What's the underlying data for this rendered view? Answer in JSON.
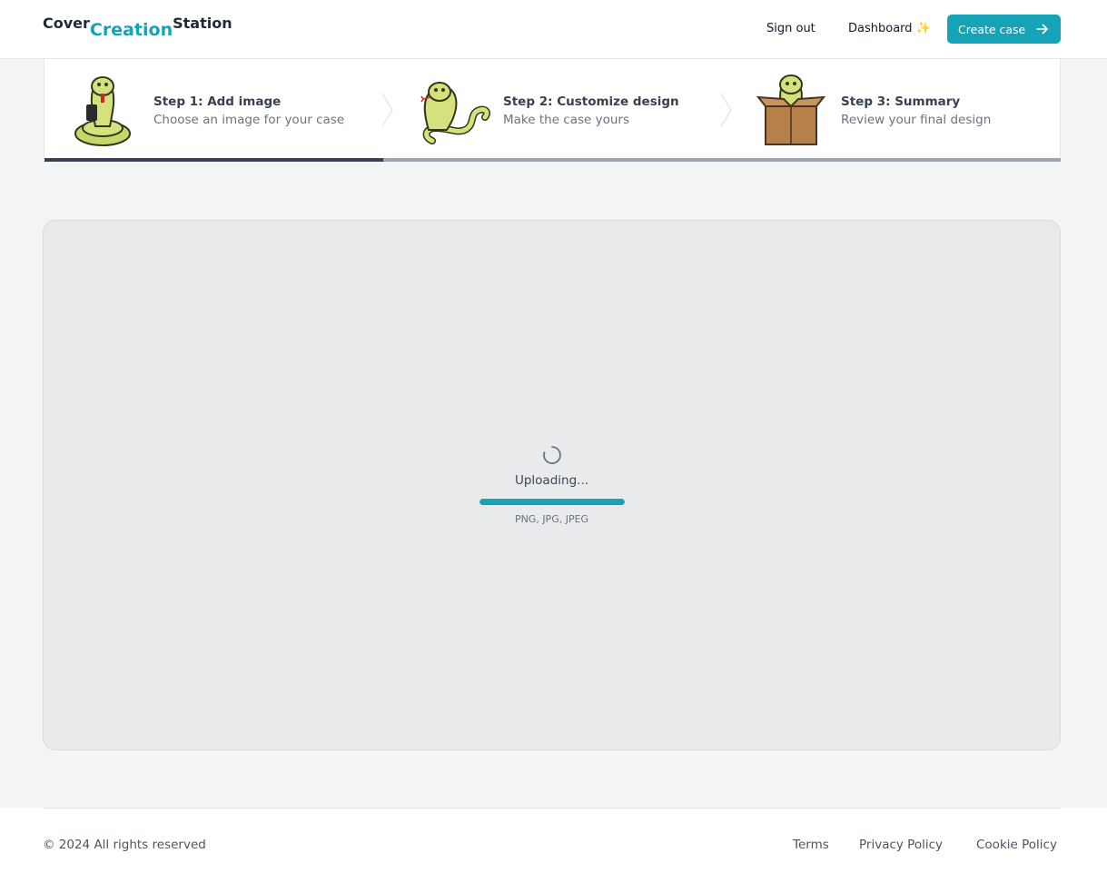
{
  "header": {
    "logo_part1": "Cover",
    "logo_part2": "Creation",
    "logo_part3": "Station",
    "sign_out_label": "Sign out",
    "dashboard_label": "Dashboard ✨",
    "create_case_label": "Create case"
  },
  "steps": [
    {
      "title": "Step 1: Add image",
      "description": "Choose an image for your case",
      "state": "current"
    },
    {
      "title": "Step 2: Customize design",
      "description": "Make the case yours",
      "state": "upcoming"
    },
    {
      "title": "Step 3: Summary",
      "description": "Review your final design",
      "state": "upcoming"
    }
  ],
  "upload": {
    "status_text": "Uploading...",
    "progress_percent": 100,
    "formats_text": "PNG, JPG, JPEG"
  },
  "footer": {
    "copyright": "© 2024 All rights reserved",
    "links": [
      "Terms",
      "Privacy Policy",
      "Cookie Policy"
    ]
  },
  "colors": {
    "accent": "#16a3b8",
    "step_active_bar": "#374151",
    "step_inactive_bar": "#9ca3af"
  },
  "icons": {
    "step1": "cobra-with-phone-icon",
    "step2": "cobra-icon",
    "step3": "cobra-in-box-icon",
    "create_case": "arrow-right-icon",
    "upload_status": "spinner-icon"
  }
}
